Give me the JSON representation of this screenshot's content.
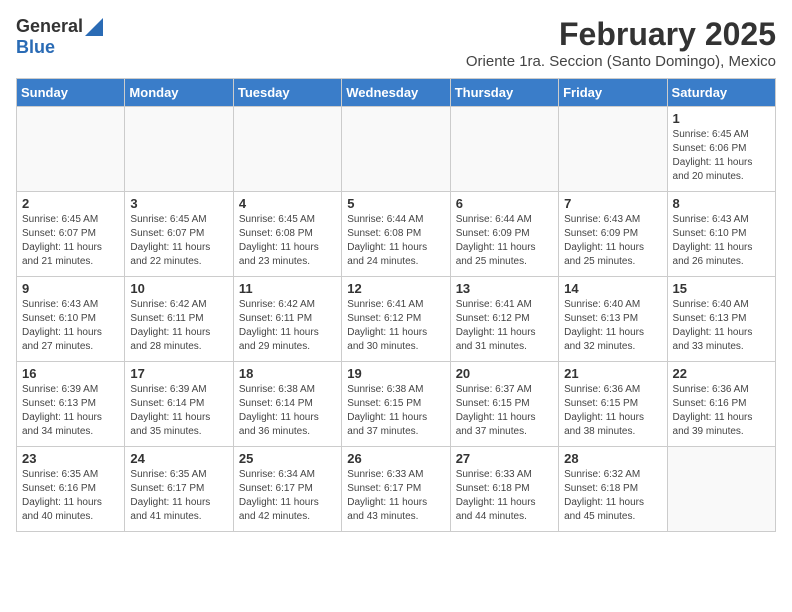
{
  "logo": {
    "general": "General",
    "blue": "Blue"
  },
  "title": "February 2025",
  "subtitle": "Oriente 1ra. Seccion (Santo Domingo), Mexico",
  "days_of_week": [
    "Sunday",
    "Monday",
    "Tuesday",
    "Wednesday",
    "Thursday",
    "Friday",
    "Saturday"
  ],
  "weeks": [
    [
      {
        "day": "",
        "info": ""
      },
      {
        "day": "",
        "info": ""
      },
      {
        "day": "",
        "info": ""
      },
      {
        "day": "",
        "info": ""
      },
      {
        "day": "",
        "info": ""
      },
      {
        "day": "",
        "info": ""
      },
      {
        "day": "1",
        "info": "Sunrise: 6:45 AM\nSunset: 6:06 PM\nDaylight: 11 hours and 20 minutes."
      }
    ],
    [
      {
        "day": "2",
        "info": "Sunrise: 6:45 AM\nSunset: 6:07 PM\nDaylight: 11 hours and 21 minutes."
      },
      {
        "day": "3",
        "info": "Sunrise: 6:45 AM\nSunset: 6:07 PM\nDaylight: 11 hours and 22 minutes."
      },
      {
        "day": "4",
        "info": "Sunrise: 6:45 AM\nSunset: 6:08 PM\nDaylight: 11 hours and 23 minutes."
      },
      {
        "day": "5",
        "info": "Sunrise: 6:44 AM\nSunset: 6:08 PM\nDaylight: 11 hours and 24 minutes."
      },
      {
        "day": "6",
        "info": "Sunrise: 6:44 AM\nSunset: 6:09 PM\nDaylight: 11 hours and 25 minutes."
      },
      {
        "day": "7",
        "info": "Sunrise: 6:43 AM\nSunset: 6:09 PM\nDaylight: 11 hours and 25 minutes."
      },
      {
        "day": "8",
        "info": "Sunrise: 6:43 AM\nSunset: 6:10 PM\nDaylight: 11 hours and 26 minutes."
      }
    ],
    [
      {
        "day": "9",
        "info": "Sunrise: 6:43 AM\nSunset: 6:10 PM\nDaylight: 11 hours and 27 minutes."
      },
      {
        "day": "10",
        "info": "Sunrise: 6:42 AM\nSunset: 6:11 PM\nDaylight: 11 hours and 28 minutes."
      },
      {
        "day": "11",
        "info": "Sunrise: 6:42 AM\nSunset: 6:11 PM\nDaylight: 11 hours and 29 minutes."
      },
      {
        "day": "12",
        "info": "Sunrise: 6:41 AM\nSunset: 6:12 PM\nDaylight: 11 hours and 30 minutes."
      },
      {
        "day": "13",
        "info": "Sunrise: 6:41 AM\nSunset: 6:12 PM\nDaylight: 11 hours and 31 minutes."
      },
      {
        "day": "14",
        "info": "Sunrise: 6:40 AM\nSunset: 6:13 PM\nDaylight: 11 hours and 32 minutes."
      },
      {
        "day": "15",
        "info": "Sunrise: 6:40 AM\nSunset: 6:13 PM\nDaylight: 11 hours and 33 minutes."
      }
    ],
    [
      {
        "day": "16",
        "info": "Sunrise: 6:39 AM\nSunset: 6:13 PM\nDaylight: 11 hours and 34 minutes."
      },
      {
        "day": "17",
        "info": "Sunrise: 6:39 AM\nSunset: 6:14 PM\nDaylight: 11 hours and 35 minutes."
      },
      {
        "day": "18",
        "info": "Sunrise: 6:38 AM\nSunset: 6:14 PM\nDaylight: 11 hours and 36 minutes."
      },
      {
        "day": "19",
        "info": "Sunrise: 6:38 AM\nSunset: 6:15 PM\nDaylight: 11 hours and 37 minutes."
      },
      {
        "day": "20",
        "info": "Sunrise: 6:37 AM\nSunset: 6:15 PM\nDaylight: 11 hours and 37 minutes."
      },
      {
        "day": "21",
        "info": "Sunrise: 6:36 AM\nSunset: 6:15 PM\nDaylight: 11 hours and 38 minutes."
      },
      {
        "day": "22",
        "info": "Sunrise: 6:36 AM\nSunset: 6:16 PM\nDaylight: 11 hours and 39 minutes."
      }
    ],
    [
      {
        "day": "23",
        "info": "Sunrise: 6:35 AM\nSunset: 6:16 PM\nDaylight: 11 hours and 40 minutes."
      },
      {
        "day": "24",
        "info": "Sunrise: 6:35 AM\nSunset: 6:17 PM\nDaylight: 11 hours and 41 minutes."
      },
      {
        "day": "25",
        "info": "Sunrise: 6:34 AM\nSunset: 6:17 PM\nDaylight: 11 hours and 42 minutes."
      },
      {
        "day": "26",
        "info": "Sunrise: 6:33 AM\nSunset: 6:17 PM\nDaylight: 11 hours and 43 minutes."
      },
      {
        "day": "27",
        "info": "Sunrise: 6:33 AM\nSunset: 6:18 PM\nDaylight: 11 hours and 44 minutes."
      },
      {
        "day": "28",
        "info": "Sunrise: 6:32 AM\nSunset: 6:18 PM\nDaylight: 11 hours and 45 minutes."
      },
      {
        "day": "",
        "info": ""
      }
    ]
  ]
}
